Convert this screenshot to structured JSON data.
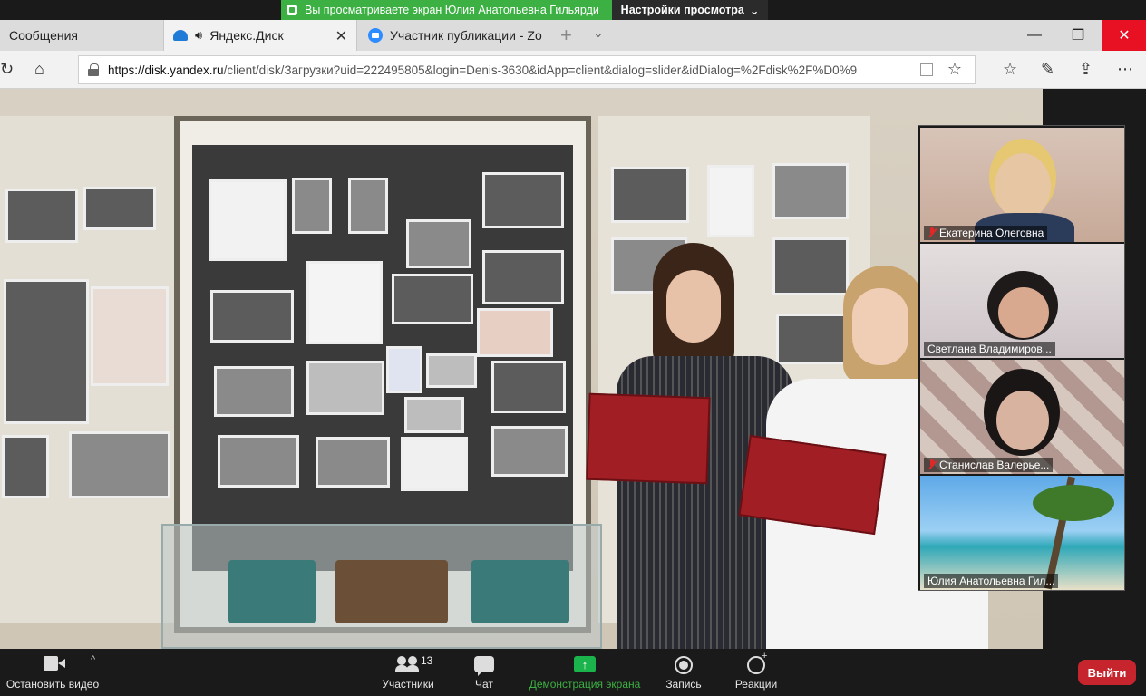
{
  "zoom_top": {
    "sharing_text": "Вы просматриваете экран Юлия Анатольевна Гильярди",
    "view_options_label": "Настройки просмотра",
    "share_color": "#3cb043"
  },
  "browser": {
    "tabs": [
      {
        "label": "Сообщения"
      },
      {
        "label": "Яндекс.Диск",
        "active": true
      },
      {
        "label": "Участник публикации - Zo"
      }
    ],
    "url_host": "https://disk.yandex.ru",
    "url_path": "/client/disk/Загрузки?uid=222495805&login=Denis-3630&idApp=client&dialog=slider&idDialog=%2Fdisk%2F%D0%9"
  },
  "participants": [
    {
      "name": "Екатерина Олеговна",
      "muted": true
    },
    {
      "name": "Светлана Владимиров...",
      "muted": false
    },
    {
      "name": "Станислав Валерье...",
      "muted": true
    },
    {
      "name": "Юлия Анатольевна Гил...",
      "muted": false
    }
  ],
  "toolbar": {
    "stop_video_label": "Остановить видео",
    "participants_label": "Участники",
    "participants_count": "13",
    "chat_label": "Чат",
    "share_label": "Демонстрация экрана",
    "record_label": "Запись",
    "reactions_label": "Реакции",
    "leave_label": "Выйти",
    "share_label_color": "#3cb043",
    "leave_color": "#c7252e"
  }
}
